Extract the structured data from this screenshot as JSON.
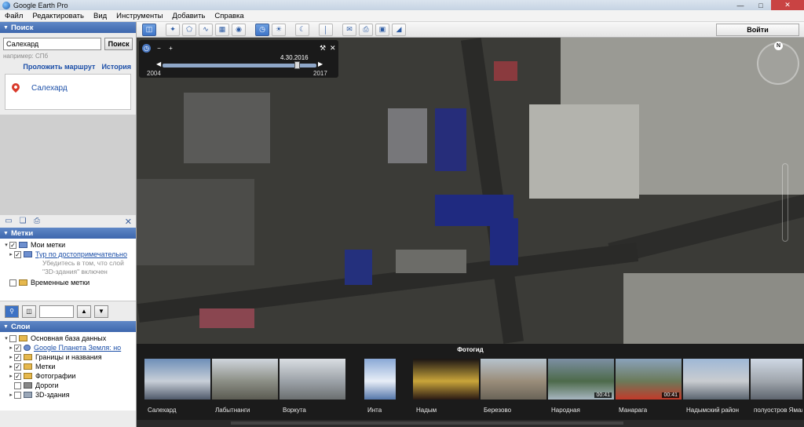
{
  "window": {
    "title": "Google Earth Pro"
  },
  "menu": [
    "Файл",
    "Редактировать",
    "Вид",
    "Инструменты",
    "Добавить",
    "Справка"
  ],
  "search": {
    "header": "Поиск",
    "value": "Салехард",
    "button": "Поиск",
    "hint": "например: СПб",
    "route_link": "Проложить маршрут",
    "history_link": "История",
    "result": "Салехард"
  },
  "places": {
    "header": "Метки",
    "my_places": "Мои метки",
    "tour": "Тур по достопримечательно",
    "tour_note": "Убедитесь в том, что слой \"3D-здания\" включен",
    "temporary": "Временные метки"
  },
  "layers": {
    "header": "Слои",
    "items": [
      {
        "label": "Основная база данных",
        "checked": false,
        "link": false
      },
      {
        "label": "Google Планета Земля: но",
        "checked": true,
        "link": true
      },
      {
        "label": "Границы и названия",
        "checked": true,
        "link": false
      },
      {
        "label": "Метки",
        "checked": true,
        "link": false
      },
      {
        "label": "Фотографии",
        "checked": true,
        "link": false
      },
      {
        "label": "Дороги",
        "checked": false,
        "link": false
      },
      {
        "label": "3D-здания",
        "checked": false,
        "link": false
      }
    ]
  },
  "toolbar": {
    "signin": "Войти"
  },
  "time_slider": {
    "current_date": "4.30.2016",
    "start_year": "2004",
    "end_year": "2017",
    "position": 0.88
  },
  "compass": {
    "north": "N"
  },
  "photo_guide": {
    "title": "Фотогид",
    "photos": [
      {
        "label": "Салехард",
        "time": "",
        "colors": [
          "#6e8fb8",
          "#c8cfd8",
          "#4f5a6a"
        ]
      },
      {
        "label": "Лабытнанги",
        "time": "",
        "colors": [
          "#cfd5dc",
          "#8c8f86",
          "#5b5b52"
        ]
      },
      {
        "label": "Воркута",
        "time": "",
        "colors": [
          "#d9dde2",
          "#9ca2a8",
          "#6b6f70"
        ]
      },
      {
        "label": "Инта",
        "time": "",
        "colors": [
          "#8aa9d6",
          "#e8eef7",
          "#5577aa"
        ]
      },
      {
        "label": "Надым",
        "time": "",
        "colors": [
          "#1a1414",
          "#c9a53a",
          "#2a1a14"
        ]
      },
      {
        "label": "Березово",
        "time": "",
        "colors": [
          "#b6c2cc",
          "#9a8d7a",
          "#6a6458"
        ]
      },
      {
        "label": "Народная",
        "time": "00:41",
        "colors": [
          "#7c8fa3",
          "#4d6a4a",
          "#a7b6c0"
        ]
      },
      {
        "label": "Манарага",
        "time": "00:41",
        "colors": [
          "#8aa2bb",
          "#6b7a5a",
          "#c23a2a"
        ]
      },
      {
        "label": "Надымский район",
        "time": "",
        "colors": [
          "#9fb8d6",
          "#c9ccd0",
          "#5b6570"
        ]
      },
      {
        "label": "полуостров Ямал",
        "time": "",
        "colors": [
          "#cfd8e4",
          "#a0a6ad",
          "#5e656e"
        ]
      }
    ]
  },
  "colors": {
    "accent": "#3d67ad",
    "link": "#1c4fa8",
    "map_bg": "#3b3b37"
  }
}
